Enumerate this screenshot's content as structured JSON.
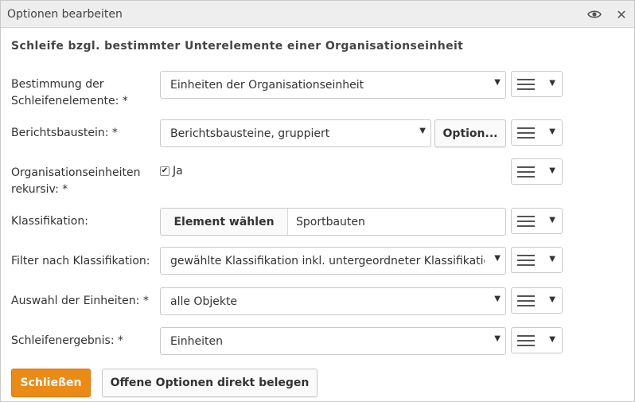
{
  "dialog": {
    "title": "Optionen bearbeiten",
    "heading": "Schleife bzgl. bestimmter Unterelemente einer Organisationseinheit"
  },
  "fields": {
    "bestimmung": {
      "label": "Bestimmung der Schleifenelemente: *",
      "value": "Einheiten der Organisationseinheit"
    },
    "berichtsbaustein": {
      "label": "Berichtsbaustein: *",
      "value": "Berichtsbausteine, gruppiert",
      "options_button": "Option..."
    },
    "rekursiv": {
      "label": "Organisationseinheiten rekursiv: *",
      "checked": true,
      "check_label": "Ja"
    },
    "klassifikation": {
      "label": "Klassifikation:",
      "choose_button": "Element wählen",
      "value": "Sportbauten"
    },
    "filter": {
      "label": "Filter nach Klassifikation:",
      "value": "gewählte Klassifikation inkl. untergeordneter Klassifikationen"
    },
    "auswahl": {
      "label": "Auswahl der Einheiten: *",
      "value": "alle Objekte"
    },
    "ergebnis": {
      "label": "Schleifenergebnis: *",
      "value": "Einheiten"
    }
  },
  "buttons": {
    "close": "Schließen",
    "assign_open": "Offene Optionen direkt belegen"
  },
  "colors": {
    "primary": "#ec8a16",
    "titlebar": "#eeeeee"
  },
  "icons": {
    "eye": "eye-icon",
    "close": "close-icon",
    "menu": "hamburger-menu-icon",
    "caret": "caret-down-icon",
    "check": "checkmark-icon"
  }
}
